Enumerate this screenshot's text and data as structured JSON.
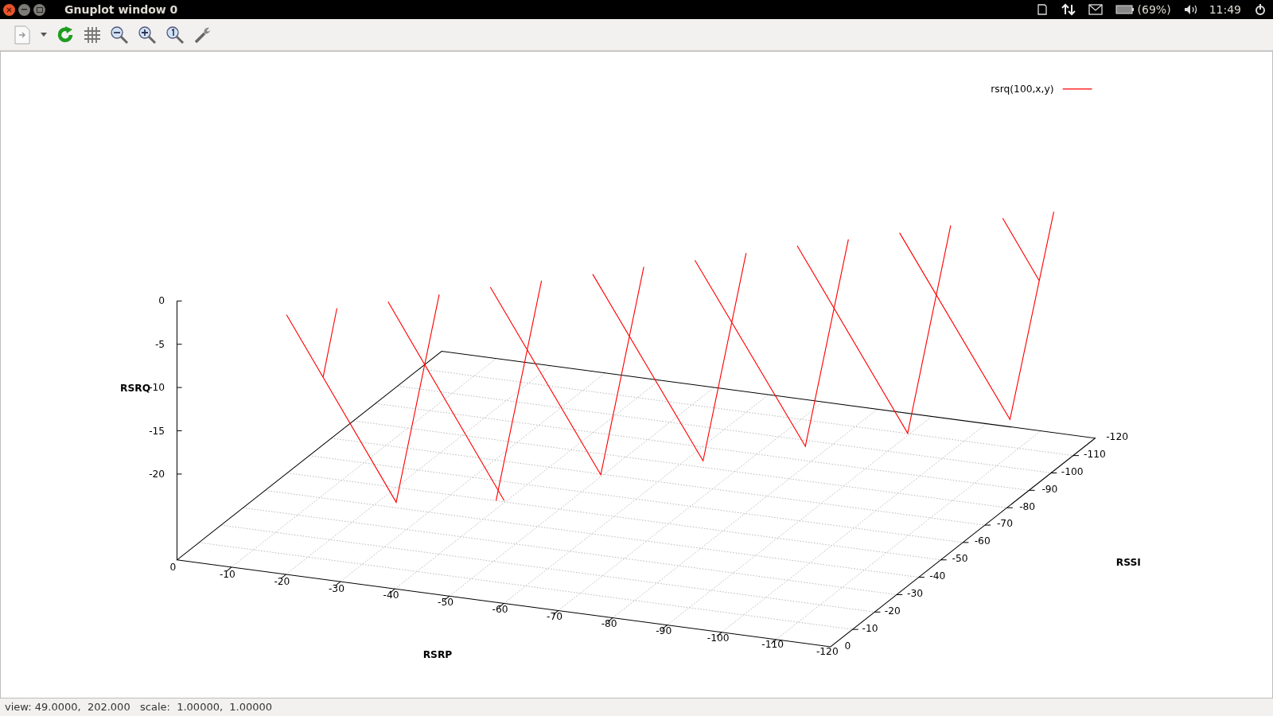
{
  "window": {
    "title": "Gnuplot window 0"
  },
  "top_panel": {
    "battery": "(69%)",
    "clock": "11:49"
  },
  "plot": {
    "legend": {
      "label": "rsrq(100,x,y)"
    },
    "x_axis": {
      "label": "RSRP",
      "ticks": [
        "0",
        "-10",
        "-20",
        "-30",
        "-40",
        "-50",
        "-60",
        "-70",
        "-80",
        "-90",
        "-100",
        "-110",
        "-120"
      ]
    },
    "y_axis": {
      "label": "RSSI",
      "ticks": [
        "0",
        "-10",
        "-20",
        "-30",
        "-40",
        "-50",
        "-60",
        "-70",
        "-80",
        "-90",
        "-100",
        "-110",
        "-120"
      ]
    },
    "z_axis": {
      "label": "RSRQ",
      "ticks": [
        "0",
        "-5",
        "-10",
        "-15",
        "-20"
      ]
    }
  },
  "status_bar": {
    "text": "view: 49.0000,  202.000   scale:  1.00000,  1.00000"
  }
}
